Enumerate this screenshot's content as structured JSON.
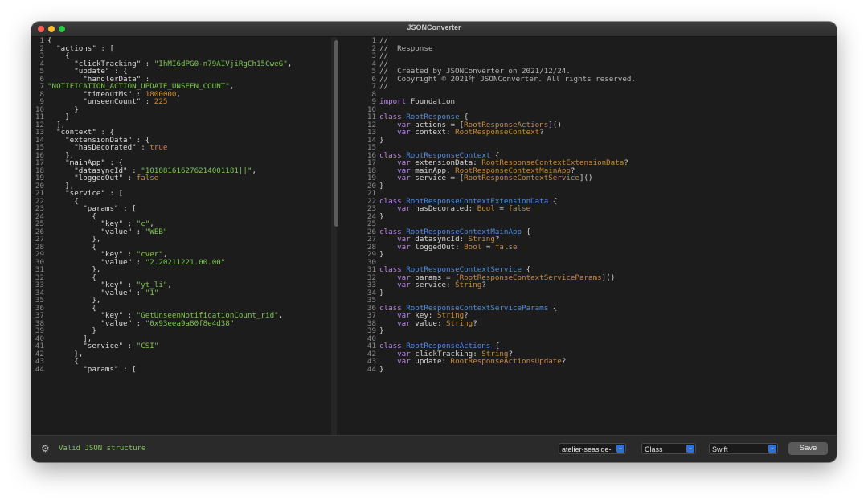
{
  "window": {
    "title": "JSONConverter"
  },
  "json_lines": [
    [
      [
        "p",
        "{"
      ]
    ],
    [
      [
        "p",
        "  "
      ],
      [
        "k",
        "\"actions\""
      ],
      [
        "p",
        " : ["
      ]
    ],
    [
      [
        "p",
        "    {"
      ]
    ],
    [
      [
        "p",
        "      "
      ],
      [
        "k",
        "\"clickTracking\""
      ],
      [
        "p",
        " : "
      ],
      [
        "s",
        "\"IhMI6dPG0-n79AIVjiRgCh15CweG\""
      ],
      [
        "p",
        ","
      ]
    ],
    [
      [
        "p",
        "      "
      ],
      [
        "k",
        "\"update\""
      ],
      [
        "p",
        " : {"
      ]
    ],
    [
      [
        "p",
        "        "
      ],
      [
        "k",
        "\"handlerData\""
      ],
      [
        "p",
        " :"
      ]
    ],
    [
      [
        "s",
        "\"NOTIFICATION_ACTION_UPDATE_UNSEEN_COUNT\""
      ],
      [
        "p",
        ","
      ]
    ],
    [
      [
        "p",
        "        "
      ],
      [
        "k",
        "\"timeoutMs\""
      ],
      [
        "p",
        " : "
      ],
      [
        "n",
        "1800000"
      ],
      [
        "p",
        ","
      ]
    ],
    [
      [
        "p",
        "        "
      ],
      [
        "k",
        "\"unseenCount\""
      ],
      [
        "p",
        " : "
      ],
      [
        "n",
        "225"
      ]
    ],
    [
      [
        "p",
        "      }"
      ]
    ],
    [
      [
        "p",
        "    }"
      ]
    ],
    [
      [
        "p",
        "  ],"
      ]
    ],
    [
      [
        "p",
        "  "
      ],
      [
        "k",
        "\"context\""
      ],
      [
        "p",
        " : {"
      ]
    ],
    [
      [
        "p",
        "    "
      ],
      [
        "k",
        "\"extensionData\""
      ],
      [
        "p",
        " : {"
      ]
    ],
    [
      [
        "p",
        "      "
      ],
      [
        "k",
        "\"hasDecorated\""
      ],
      [
        "p",
        " : "
      ],
      [
        "b",
        "true"
      ]
    ],
    [
      [
        "p",
        "    },"
      ]
    ],
    [
      [
        "p",
        "    "
      ],
      [
        "k",
        "\"mainApp\""
      ],
      [
        "p",
        " : {"
      ]
    ],
    [
      [
        "p",
        "      "
      ],
      [
        "k",
        "\"datasyncId\""
      ],
      [
        "p",
        " : "
      ],
      [
        "s",
        "\"101881616276214001181||\""
      ],
      [
        "p",
        ","
      ]
    ],
    [
      [
        "p",
        "      "
      ],
      [
        "k",
        "\"loggedOut\""
      ],
      [
        "p",
        " : "
      ],
      [
        "b",
        "false"
      ]
    ],
    [
      [
        "p",
        "    },"
      ]
    ],
    [
      [
        "p",
        "    "
      ],
      [
        "k",
        "\"service\""
      ],
      [
        "p",
        " : ["
      ]
    ],
    [
      [
        "p",
        "      {"
      ]
    ],
    [
      [
        "p",
        "        "
      ],
      [
        "k",
        "\"params\""
      ],
      [
        "p",
        " : ["
      ]
    ],
    [
      [
        "p",
        "          {"
      ]
    ],
    [
      [
        "p",
        "            "
      ],
      [
        "k",
        "\"key\""
      ],
      [
        "p",
        " : "
      ],
      [
        "s",
        "\"c\""
      ],
      [
        "p",
        ","
      ]
    ],
    [
      [
        "p",
        "            "
      ],
      [
        "k",
        "\"value\""
      ],
      [
        "p",
        " : "
      ],
      [
        "s",
        "\"WEB\""
      ]
    ],
    [
      [
        "p",
        "          },"
      ]
    ],
    [
      [
        "p",
        "          {"
      ]
    ],
    [
      [
        "p",
        "            "
      ],
      [
        "k",
        "\"key\""
      ],
      [
        "p",
        " : "
      ],
      [
        "s",
        "\"cver\""
      ],
      [
        "p",
        ","
      ]
    ],
    [
      [
        "p",
        "            "
      ],
      [
        "k",
        "\"value\""
      ],
      [
        "p",
        " : "
      ],
      [
        "s",
        "\"2.20211221.00.00\""
      ]
    ],
    [
      [
        "p",
        "          },"
      ]
    ],
    [
      [
        "p",
        "          {"
      ]
    ],
    [
      [
        "p",
        "            "
      ],
      [
        "k",
        "\"key\""
      ],
      [
        "p",
        " : "
      ],
      [
        "s",
        "\"yt_li\""
      ],
      [
        "p",
        ","
      ]
    ],
    [
      [
        "p",
        "            "
      ],
      [
        "k",
        "\"value\""
      ],
      [
        "p",
        " : "
      ],
      [
        "s",
        "\"1\""
      ]
    ],
    [
      [
        "p",
        "          },"
      ]
    ],
    [
      [
        "p",
        "          {"
      ]
    ],
    [
      [
        "p",
        "            "
      ],
      [
        "k",
        "\"key\""
      ],
      [
        "p",
        " : "
      ],
      [
        "s",
        "\"GetUnseenNotificationCount_rid\""
      ],
      [
        "p",
        ","
      ]
    ],
    [
      [
        "p",
        "            "
      ],
      [
        "k",
        "\"value\""
      ],
      [
        "p",
        " : "
      ],
      [
        "s",
        "\"0x93eea9a80f8e4d38\""
      ]
    ],
    [
      [
        "p",
        "          }"
      ]
    ],
    [
      [
        "p",
        "        ],"
      ]
    ],
    [
      [
        "p",
        "        "
      ],
      [
        "k",
        "\"service\""
      ],
      [
        "p",
        " : "
      ],
      [
        "s",
        "\"CSI\""
      ]
    ],
    [
      [
        "p",
        "      },"
      ]
    ],
    [
      [
        "p",
        "      {"
      ]
    ],
    [
      [
        "p",
        "        "
      ],
      [
        "k",
        "\"params\""
      ],
      [
        "p",
        " : ["
      ]
    ]
  ],
  "swift_lines": [
    [
      [
        "cm",
        "//"
      ]
    ],
    [
      [
        "cm",
        "//  Response"
      ]
    ],
    [
      [
        "cm",
        "//"
      ]
    ],
    [
      [
        "cm",
        "//"
      ]
    ],
    [
      [
        "cm",
        "//  Created by JSONConverter on 2021/12/24."
      ]
    ],
    [
      [
        "cm",
        "//  Copyright © 2021年 JSONConverter. All rights reserved."
      ]
    ],
    [
      [
        "cm",
        "//"
      ]
    ],
    [],
    [
      [
        "kw",
        "import"
      ],
      [
        "p",
        " Foundation"
      ]
    ],
    [],
    [
      [
        "kw",
        "class"
      ],
      [
        "p",
        " "
      ],
      [
        "ty",
        "RootResponse"
      ],
      [
        "p",
        " {"
      ]
    ],
    [
      [
        "p",
        "    "
      ],
      [
        "kw",
        "var"
      ],
      [
        "p",
        " actions = ["
      ],
      [
        "tp",
        "RootResponseActions"
      ],
      [
        "p",
        "]()"
      ]
    ],
    [
      [
        "p",
        "    "
      ],
      [
        "kw",
        "var"
      ],
      [
        "p",
        " context: "
      ],
      [
        "tp",
        "RootResponseContext"
      ],
      [
        "p",
        "?"
      ]
    ],
    [
      [
        "p",
        "}"
      ]
    ],
    [],
    [
      [
        "kw",
        "class"
      ],
      [
        "p",
        " "
      ],
      [
        "ty",
        "RootResponseContext"
      ],
      [
        "p",
        " {"
      ]
    ],
    [
      [
        "p",
        "    "
      ],
      [
        "kw",
        "var"
      ],
      [
        "p",
        " extensionData: "
      ],
      [
        "tp",
        "RootResponseContextExtensionData"
      ],
      [
        "p",
        "?"
      ]
    ],
    [
      [
        "p",
        "    "
      ],
      [
        "kw",
        "var"
      ],
      [
        "p",
        " mainApp: "
      ],
      [
        "tp",
        "RootResponseContextMainApp"
      ],
      [
        "p",
        "?"
      ]
    ],
    [
      [
        "p",
        "    "
      ],
      [
        "kw",
        "var"
      ],
      [
        "p",
        " service = ["
      ],
      [
        "tp",
        "RootResponseContextService"
      ],
      [
        "p",
        "]()"
      ]
    ],
    [
      [
        "p",
        "}"
      ]
    ],
    [],
    [
      [
        "kw",
        "class"
      ],
      [
        "p",
        " "
      ],
      [
        "ty",
        "RootResponseContextExtensionData"
      ],
      [
        "p",
        " {"
      ]
    ],
    [
      [
        "p",
        "    "
      ],
      [
        "kw",
        "var"
      ],
      [
        "p",
        " hasDecorated: "
      ],
      [
        "tp",
        "Bool"
      ],
      [
        "p",
        " = "
      ],
      [
        "tp",
        "false"
      ]
    ],
    [
      [
        "p",
        "}"
      ]
    ],
    [],
    [
      [
        "kw",
        "class"
      ],
      [
        "p",
        " "
      ],
      [
        "ty",
        "RootResponseContextMainApp"
      ],
      [
        "p",
        " {"
      ]
    ],
    [
      [
        "p",
        "    "
      ],
      [
        "kw",
        "var"
      ],
      [
        "p",
        " datasyncId: "
      ],
      [
        "tp",
        "String"
      ],
      [
        "p",
        "?"
      ]
    ],
    [
      [
        "p",
        "    "
      ],
      [
        "kw",
        "var"
      ],
      [
        "p",
        " loggedOut: "
      ],
      [
        "tp",
        "Bool"
      ],
      [
        "p",
        " = "
      ],
      [
        "tp",
        "false"
      ]
    ],
    [
      [
        "p",
        "}"
      ]
    ],
    [],
    [
      [
        "kw",
        "class"
      ],
      [
        "p",
        " "
      ],
      [
        "ty",
        "RootResponseContextService"
      ],
      [
        "p",
        " {"
      ]
    ],
    [
      [
        "p",
        "    "
      ],
      [
        "kw",
        "var"
      ],
      [
        "p",
        " params = ["
      ],
      [
        "tp",
        "RootResponseContextServiceParams"
      ],
      [
        "p",
        "]()"
      ]
    ],
    [
      [
        "p",
        "    "
      ],
      [
        "kw",
        "var"
      ],
      [
        "p",
        " service: "
      ],
      [
        "tp",
        "String"
      ],
      [
        "p",
        "?"
      ]
    ],
    [
      [
        "p",
        "}"
      ]
    ],
    [],
    [
      [
        "kw",
        "class"
      ],
      [
        "p",
        " "
      ],
      [
        "ty",
        "RootResponseContextServiceParams"
      ],
      [
        "p",
        " {"
      ]
    ],
    [
      [
        "p",
        "    "
      ],
      [
        "kw",
        "var"
      ],
      [
        "p",
        " key: "
      ],
      [
        "tp",
        "String"
      ],
      [
        "p",
        "?"
      ]
    ],
    [
      [
        "p",
        "    "
      ],
      [
        "kw",
        "var"
      ],
      [
        "p",
        " value: "
      ],
      [
        "tp",
        "String"
      ],
      [
        "p",
        "?"
      ]
    ],
    [
      [
        "p",
        "}"
      ]
    ],
    [],
    [
      [
        "kw",
        "class"
      ],
      [
        "p",
        " "
      ],
      [
        "ty",
        "RootResponseActions"
      ],
      [
        "p",
        " {"
      ]
    ],
    [
      [
        "p",
        "    "
      ],
      [
        "kw",
        "var"
      ],
      [
        "p",
        " clickTracking: "
      ],
      [
        "tp",
        "String"
      ],
      [
        "p",
        "?"
      ]
    ],
    [
      [
        "p",
        "    "
      ],
      [
        "kw",
        "var"
      ],
      [
        "p",
        " update: "
      ],
      [
        "tp",
        "RootResponseActionsUpdate"
      ],
      [
        "p",
        "?"
      ]
    ],
    [
      [
        "p",
        "}"
      ]
    ]
  ],
  "status": {
    "message": "Valid JSON structure",
    "icon": "gear-icon"
  },
  "toolbar": {
    "theme_select": "atelier-seaside-",
    "kind_select": "Class",
    "language_select": "Swift",
    "save_label": "Save",
    "chevron_icon": "chevron-updown-icon"
  },
  "colors": {
    "json_string": "#7ec850",
    "json_number": "#d08a2e",
    "swift_keyword": "#b887e6",
    "swift_class_name": "#4f8ce0",
    "swift_type": "#c78a3a",
    "select_accent": "#2f6fd8"
  }
}
